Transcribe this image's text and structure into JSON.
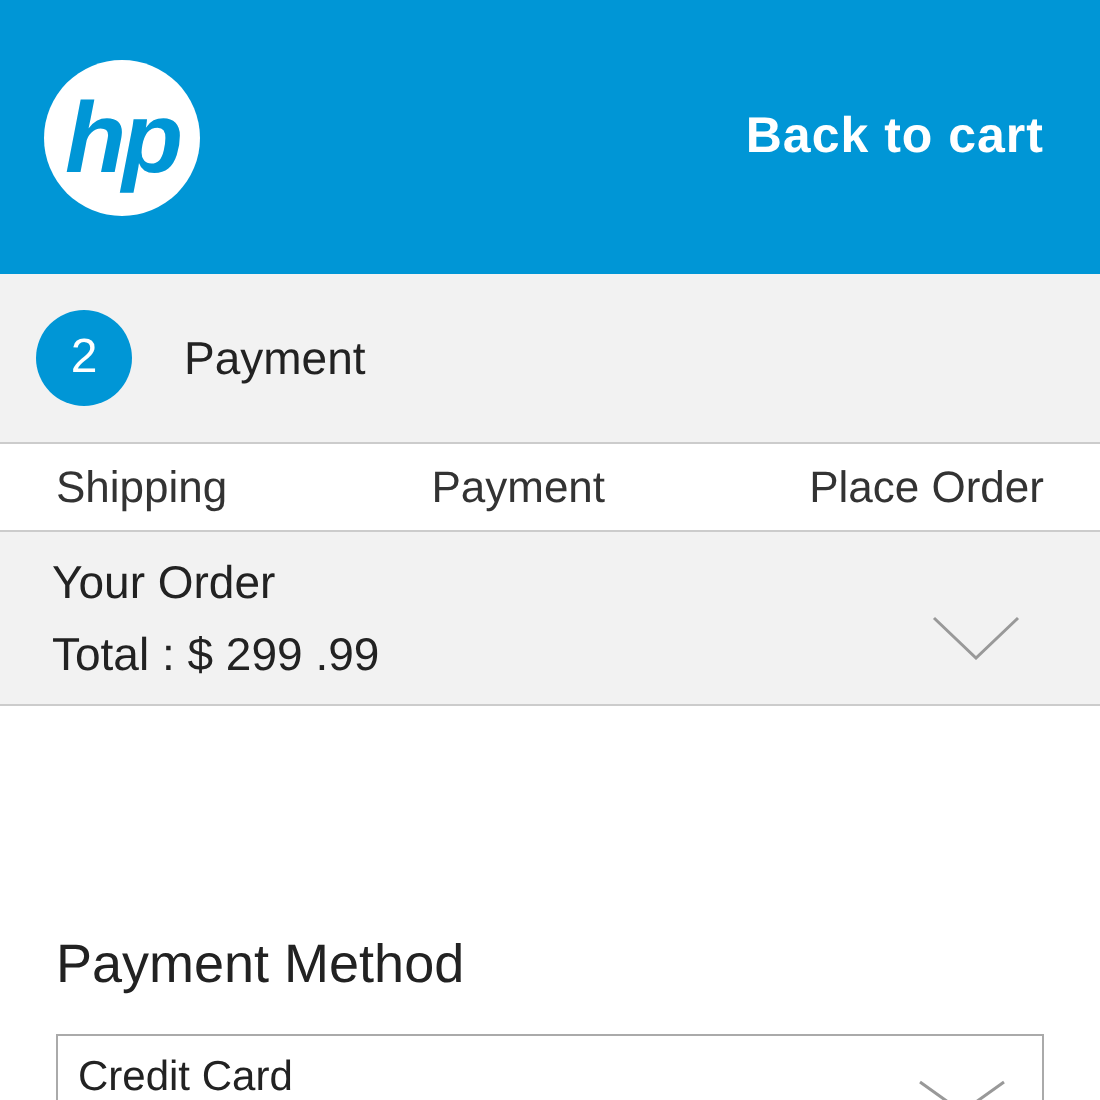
{
  "header": {
    "logo": "hp",
    "back_link": "Back to cart"
  },
  "current_step": {
    "number": "2",
    "label": "Payment"
  },
  "steps": [
    {
      "label": "Shipping"
    },
    {
      "label": "Payment"
    },
    {
      "label": "Place Order"
    }
  ],
  "order_summary": {
    "title": "Your Order",
    "total": "Total : $ 299 .99",
    "expanded": false
  },
  "payment_method": {
    "label": "Payment Method",
    "value": "Credit Card"
  }
}
